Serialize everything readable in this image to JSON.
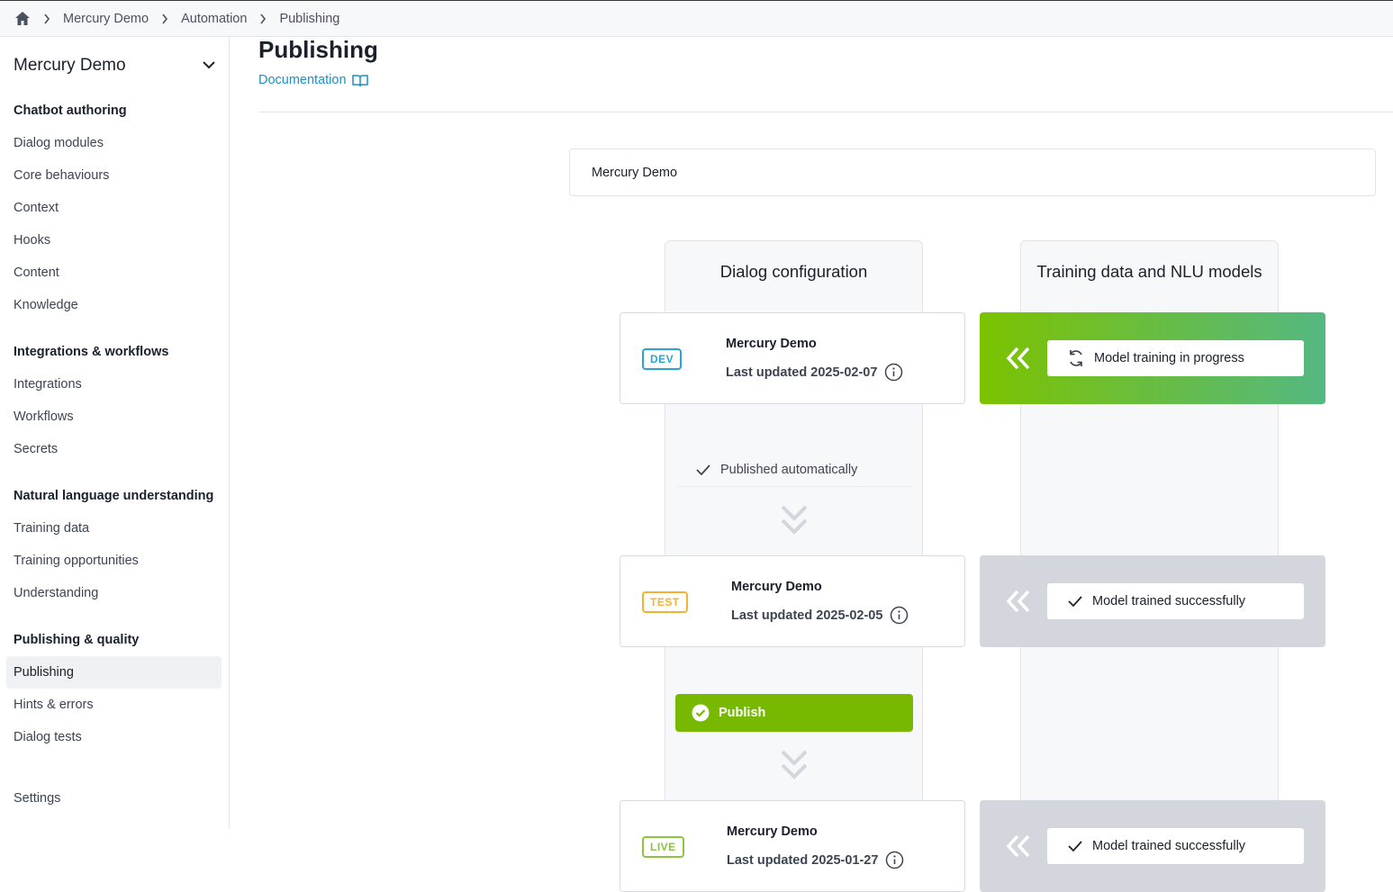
{
  "breadcrumb": {
    "home_icon": "home-icon",
    "items": [
      "Mercury Demo",
      "Automation",
      "Publishing"
    ]
  },
  "sidebar": {
    "project_name": "Mercury Demo",
    "sections": [
      {
        "title": "Chatbot authoring",
        "items": [
          "Dialog modules",
          "Core behaviours",
          "Context",
          "Hooks",
          "Content",
          "Knowledge"
        ]
      },
      {
        "title": "Integrations & workflows",
        "items": [
          "Integrations",
          "Workflows",
          "Secrets"
        ]
      },
      {
        "title": "Natural language understanding",
        "items": [
          "Training data",
          "Training opportunities",
          "Understanding"
        ]
      },
      {
        "title": "Publishing & quality",
        "items": [
          "Publishing",
          "Hints & errors",
          "Dialog tests"
        ]
      }
    ],
    "settings": "Settings",
    "active_item": "Publishing"
  },
  "main": {
    "title": "Publishing",
    "doc_link": "Documentation",
    "project_box": "Mercury Demo",
    "columns": {
      "dialog": "Dialog configuration",
      "nlu": "Training data and NLU models"
    },
    "environments": [
      {
        "badge": "DEV",
        "name": "Mercury Demo",
        "updated": "Last updated 2025-02-07",
        "model_status": "Model training in progress"
      },
      {
        "badge": "TEST",
        "name": "Mercury Demo",
        "updated": "Last updated 2025-02-05",
        "model_status": "Model trained successfully"
      },
      {
        "badge": "LIVE",
        "name": "Mercury Demo",
        "updated": "Last updated 2025-01-27",
        "model_status": "Model trained successfully"
      }
    ],
    "published_auto": "Published automatically",
    "publish_button": "Publish"
  },
  "colors": {
    "dev": "#2aa4d5",
    "test": "#f2b233",
    "live": "#8cc43f",
    "publish": "#76b900",
    "link": "#1f8fc4"
  }
}
